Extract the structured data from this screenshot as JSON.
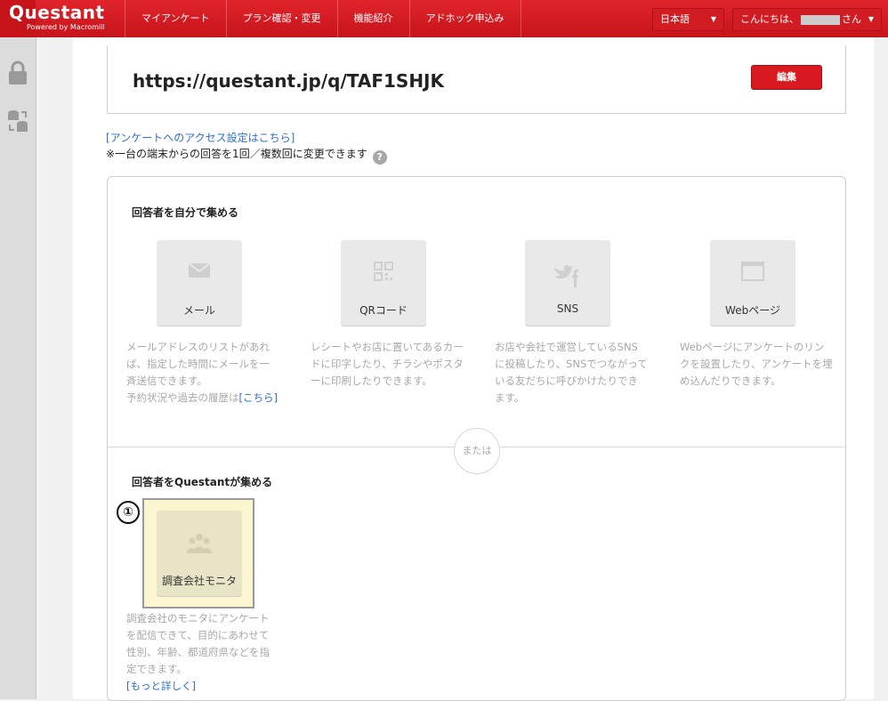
{
  "logo": {
    "name": "Questant",
    "sub": "Powered by Macromill"
  },
  "nav": [
    {
      "label": "マイアンケート"
    },
    {
      "label": "プラン確認・変更"
    },
    {
      "label": "機能紹介"
    },
    {
      "label": "アドホック申込み"
    }
  ],
  "language": {
    "selected": "日本語"
  },
  "user": {
    "greeting": "こんにちは、",
    "suffix": "さん"
  },
  "survey": {
    "url": "https://questant.jp/q/TAF1SHJK",
    "edit_label": "編集",
    "access_link": "[アンケートへのアクセス設定はこちら]",
    "note": "※一台の端末からの回答を1回／複数回に変更できます"
  },
  "self_collect": {
    "title": "回答者を自分で集める",
    "methods": [
      {
        "label": "メール",
        "icon": "envelope-icon",
        "desc": "メールアドレスのリストがあれば、指定した時間にメールを一斉送信できます。",
        "desc2": "予約状況や過去の履歴は",
        "link": "[こちら]"
      },
      {
        "label": "QRコード",
        "icon": "qr-code-icon",
        "desc": "レシートやお店に置いてあるカードに印字したり、チラシやポスターに印刷したりできます。"
      },
      {
        "label": "SNS",
        "icon": "twitter-facebook-icon",
        "desc": "お店や会社で運営しているSNSに投稿したり、SNSでつながっている友だちに呼びかけたりできます。"
      },
      {
        "label": "Webページ",
        "icon": "browser-window-icon",
        "desc": "Webページにアンケートのリンクを設置したり、アンケートを埋め込んだりできます。"
      }
    ]
  },
  "or_label": "または",
  "questant_collect": {
    "title": "回答者をQuestantが集める",
    "marker": "①",
    "card": {
      "label": "調査会社モニタ",
      "icon": "people-group-icon"
    },
    "desc": "調査会社のモニタにアンケートを配信できて、目的にあわせて性別、年齢、都道府県などを指定できます。",
    "link": "[もっと詳しく]"
  }
}
